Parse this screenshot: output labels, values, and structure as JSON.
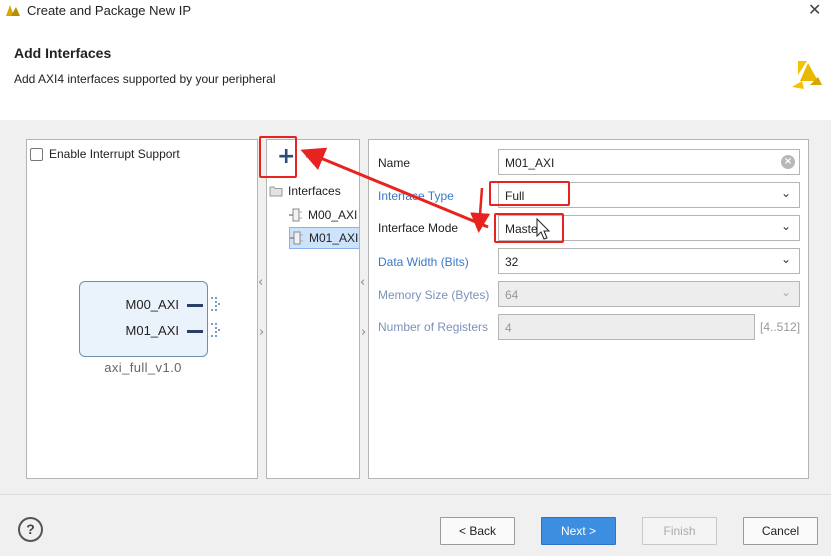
{
  "window": {
    "title": "Create and Package New IP"
  },
  "header": {
    "title": "Add Interfaces",
    "subtitle": "Add AXI4 interfaces supported by your peripheral"
  },
  "left_panel": {
    "interrupt_checkbox_label": "Enable Interrupt Support",
    "interrupt_checked": false,
    "ip_block": {
      "ports": [
        "M00_AXI",
        "M01_AXI"
      ],
      "name": "axi_full_v1.0"
    }
  },
  "interfaces_panel": {
    "add_glyph": "+",
    "remove_glyph": "−",
    "root_label": "Interfaces",
    "items": [
      "M00_AXI",
      "M01_AXI"
    ],
    "selected_index": 1
  },
  "properties": {
    "name_label": "Name",
    "name_value": "M01_AXI",
    "interface_type_label": "Interface Type",
    "interface_type_value": "Full",
    "interface_mode_label": "Interface Mode",
    "interface_mode_value": "Master",
    "data_width_label": "Data Width (Bits)",
    "data_width_value": "32",
    "memory_size_label": "Memory Size (Bytes)",
    "memory_size_value": "64",
    "num_registers_label": "Number of Registers",
    "num_registers_value": "4",
    "num_registers_range": "[4..512]"
  },
  "footer": {
    "help_glyph": "?",
    "back_label": "< Back",
    "next_label": "Next >",
    "finish_label": "Finish",
    "cancel_label": "Cancel"
  },
  "colors": {
    "accent_blue": "#3c8ee0",
    "label_blue": "#3a78c8",
    "annotation_red": "#e8221f",
    "logo_yellow": "#f2c400"
  },
  "icons": {
    "titlebar": "vivado-logo-icon",
    "header": "xilinx-logo-icon",
    "clear": "clear-icon",
    "dropdown": "chevron-down-icon",
    "tree_folder": "folder-icon",
    "tree_item": "interface-port-icon",
    "cursor": "mouse-cursor-icon"
  }
}
